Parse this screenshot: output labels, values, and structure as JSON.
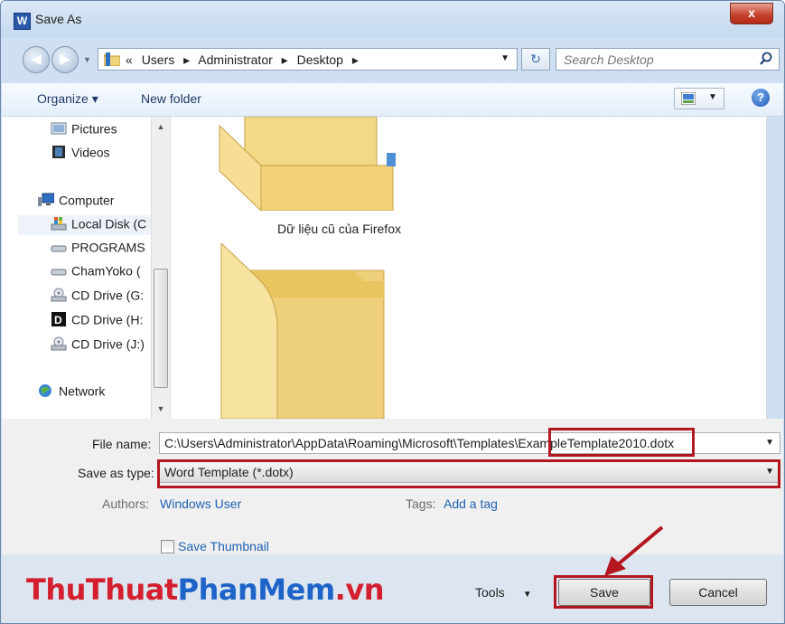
{
  "window": {
    "title": "Save As",
    "app_icon_letter": "W",
    "close_glyph": "x"
  },
  "address": {
    "crumbs": [
      "«",
      "Users",
      "▸",
      "Administrator",
      "▸",
      "Desktop",
      "▸"
    ],
    "search_placeholder": "Search Desktop"
  },
  "toolbar": {
    "organize": "Organize ▾",
    "new_folder": "New folder",
    "help": "?"
  },
  "nav": {
    "items": [
      "Pictures",
      "Videos",
      "Computer",
      "Local Disk (C",
      "PROGRAMS",
      "ChamYoko (",
      "CD Drive (G:",
      "CD Drive (H:",
      "CD Drive (J:)",
      "Network"
    ]
  },
  "files": {
    "folder1_label": "Dữ liệu cũ của Firefox"
  },
  "form": {
    "file_name_label": "File name:",
    "file_name_value": "C:\\Users\\Administrator\\AppData\\Roaming\\Microsoft\\Templates\\ExampleTemplate2010.dotx",
    "type_label": "Save as type:",
    "type_value": "Word Template (*.dotx)",
    "authors_label": "Authors:",
    "authors_value": "Windows User",
    "tags_label": "Tags:",
    "tags_value": "Add a tag",
    "thumbnail_label": "Save Thumbnail"
  },
  "buttons": {
    "tools": "Tools",
    "save": "Save",
    "cancel": "Cancel"
  },
  "watermark": {
    "part1": "ThuThuat",
    "part2": "PhanMem",
    "part3": ".vn"
  },
  "colors": {
    "highlight": "#b3161f",
    "link": "#1e62b4",
    "watermark_red": "#d4202e",
    "watermark_blue": "#1e64c8"
  }
}
